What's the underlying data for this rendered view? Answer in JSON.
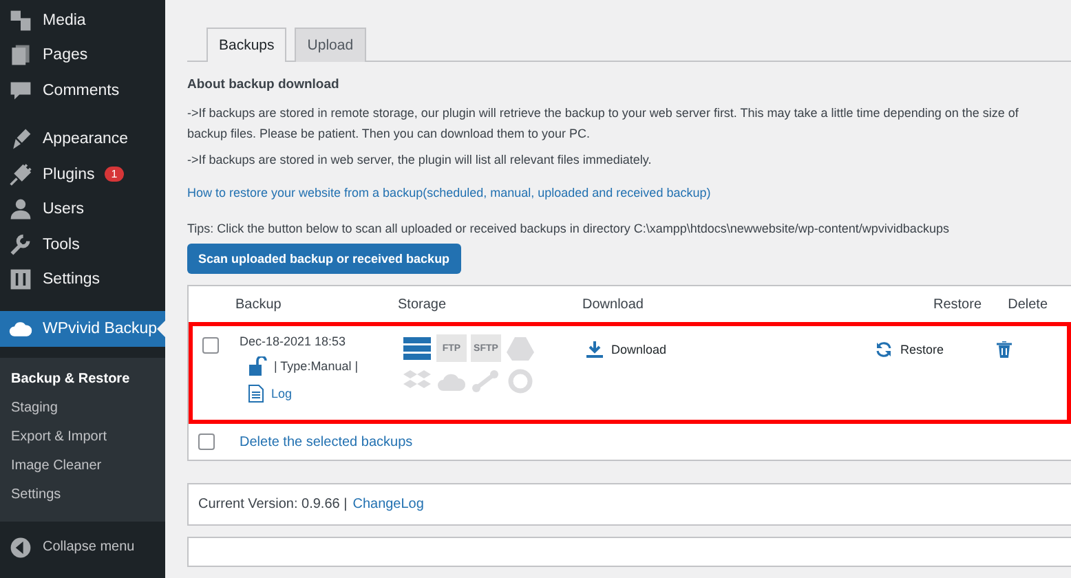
{
  "sidebar": {
    "sections": [
      {
        "items": [
          {
            "label": "Media",
            "kind": "media",
            "selected": false
          },
          {
            "label": "Pages",
            "kind": "pages",
            "selected": false
          },
          {
            "label": "Comments",
            "kind": "comments",
            "selected": false
          }
        ]
      },
      {
        "items": [
          {
            "label": "Appearance",
            "kind": "appearance",
            "selected": false
          },
          {
            "label": "Plugins",
            "kind": "plugins",
            "selected": false,
            "badge": "1"
          },
          {
            "label": "Users",
            "kind": "users",
            "selected": false
          },
          {
            "label": "Tools",
            "kind": "tools",
            "selected": false
          },
          {
            "label": "Settings",
            "kind": "settings",
            "selected": false
          }
        ]
      },
      {
        "items": [
          {
            "label": "WPvivid Backup",
            "kind": "cloud",
            "selected": true
          }
        ]
      }
    ],
    "submenu": [
      {
        "label": "Backup & Restore",
        "selected": true
      },
      {
        "label": "Staging",
        "selected": false
      },
      {
        "label": "Export & Import",
        "selected": false
      },
      {
        "label": "Image Cleaner",
        "selected": false
      },
      {
        "label": "Settings",
        "selected": false
      }
    ],
    "collapse": "Collapse menu"
  },
  "tabs": [
    {
      "label": "Backups",
      "selected": true
    },
    {
      "label": "Upload",
      "selected": false
    }
  ],
  "about": {
    "title": "About backup download",
    "paragraphs": [
      "->If backups are stored in remote storage, our plugin will retrieve the backup to your web server first. This may take a little time depending on the size of backup files. Please be patient. Then you can download them to your PC.",
      "->If backups are stored in web server, the plugin will list all relevant files immediately."
    ],
    "link": "How to restore your website from a backup(scheduled, manual, uploaded and received backup)"
  },
  "tips": "Tips: Click the button below to scan all uploaded or received backups in directory C:\\xampp\\htdocs\\newwebsite/wp-content/wpvividbackups",
  "scan_button": "Scan uploaded backup or received backup",
  "table": {
    "columns": [
      "Backup",
      "Storage",
      "Download",
      "Restore",
      "Delete"
    ],
    "rows": [
      {
        "checked": false,
        "highlighted": true,
        "date": "Dec-18-2021 18:53",
        "type": "| Type:Manual |",
        "log": "Log",
        "download": "Download",
        "restore": "Restore",
        "storage": [
          {
            "kind": "server",
            "on": true
          },
          {
            "kind": "text",
            "label": "FTP",
            "on": false
          },
          {
            "kind": "text",
            "label": "SFTP",
            "on": false
          },
          {
            "kind": "drive",
            "on": false
          },
          {
            "kind": "dropbox",
            "on": false
          },
          {
            "kind": "cloud",
            "on": false
          },
          {
            "kind": "share",
            "on": false
          },
          {
            "kind": "ring",
            "on": false
          }
        ]
      }
    ],
    "footer": {
      "checked": false,
      "label": "Delete the selected backups"
    }
  },
  "version": {
    "label": "Current Version: 0.9.66 |",
    "link": "ChangeLog"
  }
}
